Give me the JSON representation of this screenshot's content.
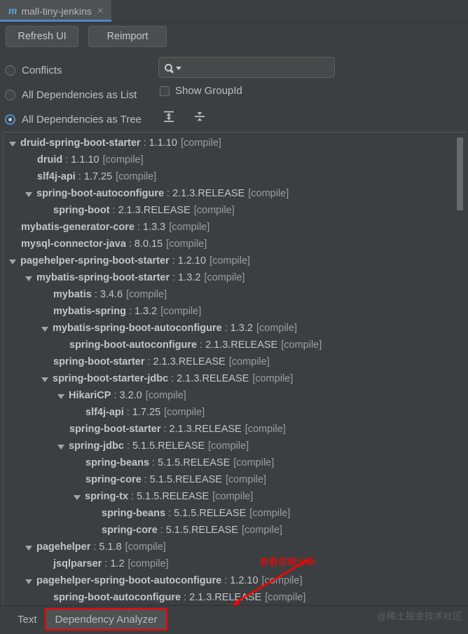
{
  "tab": {
    "icon": "maven-m-icon",
    "title": "mall-tiny-jenkins",
    "close": "×"
  },
  "toolbar": {
    "refresh_label": "Refresh UI",
    "reimport_label": "Reimport"
  },
  "options": {
    "items": [
      {
        "label": "Conflicts",
        "selected": false
      },
      {
        "label": "All Dependencies as List",
        "selected": false
      },
      {
        "label": "All Dependencies as Tree",
        "selected": true
      }
    ]
  },
  "search": {
    "value": "",
    "placeholder": "",
    "icon": "search-icon",
    "dropdown_icon": "chevron-down-icon"
  },
  "show_groupid": {
    "label": "Show GroupId",
    "checked": false
  },
  "tree_tools": {
    "expand_all": "expand-all-icon",
    "collapse_all": "collapse-all-icon"
  },
  "tree": {
    "scope_suffix": "[compile]",
    "separator": ":",
    "rows": [
      {
        "depth": 0,
        "expanded": true,
        "artifact": "druid-spring-boot-starter",
        "version": "1.1.10",
        "scope": "[compile]"
      },
      {
        "depth": 1,
        "expanded": null,
        "artifact": "druid",
        "version": "1.1.10",
        "scope": "[compile]"
      },
      {
        "depth": 1,
        "expanded": null,
        "artifact": "slf4j-api",
        "version": "1.7.25",
        "scope": "[compile]"
      },
      {
        "depth": 1,
        "expanded": true,
        "artifact": "spring-boot-autoconfigure",
        "version": "2.1.3.RELEASE",
        "scope": "[compile]"
      },
      {
        "depth": 2,
        "expanded": null,
        "artifact": "spring-boot",
        "version": "2.1.3.RELEASE",
        "scope": "[compile]"
      },
      {
        "depth": 0,
        "expanded": null,
        "artifact": "mybatis-generator-core",
        "version": "1.3.3",
        "scope": "[compile]"
      },
      {
        "depth": 0,
        "expanded": null,
        "artifact": "mysql-connector-java",
        "version": "8.0.15",
        "scope": "[compile]"
      },
      {
        "depth": 0,
        "expanded": true,
        "artifact": "pagehelper-spring-boot-starter",
        "version": "1.2.10",
        "scope": "[compile]"
      },
      {
        "depth": 1,
        "expanded": true,
        "artifact": "mybatis-spring-boot-starter",
        "version": "1.3.2",
        "scope": "[compile]"
      },
      {
        "depth": 2,
        "expanded": null,
        "artifact": "mybatis",
        "version": "3.4.6",
        "scope": "[compile]"
      },
      {
        "depth": 2,
        "expanded": null,
        "artifact": "mybatis-spring",
        "version": "1.3.2",
        "scope": "[compile]"
      },
      {
        "depth": 2,
        "expanded": true,
        "artifact": "mybatis-spring-boot-autoconfigure",
        "version": "1.3.2",
        "scope": "[compile]"
      },
      {
        "depth": 3,
        "expanded": null,
        "artifact": "spring-boot-autoconfigure",
        "version": "2.1.3.RELEASE",
        "scope": "[compile]"
      },
      {
        "depth": 2,
        "expanded": null,
        "artifact": "spring-boot-starter",
        "version": "2.1.3.RELEASE",
        "scope": "[compile]"
      },
      {
        "depth": 2,
        "expanded": true,
        "artifact": "spring-boot-starter-jdbc",
        "version": "2.1.3.RELEASE",
        "scope": "[compile]"
      },
      {
        "depth": 3,
        "expanded": true,
        "artifact": "HikariCP",
        "version": "3.2.0",
        "scope": "[compile]"
      },
      {
        "depth": 4,
        "expanded": null,
        "artifact": "slf4j-api",
        "version": "1.7.25",
        "scope": "[compile]"
      },
      {
        "depth": 3,
        "expanded": null,
        "artifact": "spring-boot-starter",
        "version": "2.1.3.RELEASE",
        "scope": "[compile]"
      },
      {
        "depth": 3,
        "expanded": true,
        "artifact": "spring-jdbc",
        "version": "5.1.5.RELEASE",
        "scope": "[compile]"
      },
      {
        "depth": 4,
        "expanded": null,
        "artifact": "spring-beans",
        "version": "5.1.5.RELEASE",
        "scope": "[compile]"
      },
      {
        "depth": 4,
        "expanded": null,
        "artifact": "spring-core",
        "version": "5.1.5.RELEASE",
        "scope": "[compile]"
      },
      {
        "depth": 4,
        "expanded": true,
        "artifact": "spring-tx",
        "version": "5.1.5.RELEASE",
        "scope": "[compile]"
      },
      {
        "depth": 5,
        "expanded": null,
        "artifact": "spring-beans",
        "version": "5.1.5.RELEASE",
        "scope": "[compile]"
      },
      {
        "depth": 5,
        "expanded": null,
        "artifact": "spring-core",
        "version": "5.1.5.RELEASE",
        "scope": "[compile]"
      },
      {
        "depth": 1,
        "expanded": true,
        "artifact": "pagehelper",
        "version": "5.1.8",
        "scope": "[compile]"
      },
      {
        "depth": 2,
        "expanded": null,
        "artifact": "jsqlparser",
        "version": "1.2",
        "scope": "[compile]"
      },
      {
        "depth": 1,
        "expanded": true,
        "artifact": "pagehelper-spring-boot-autoconfigure",
        "version": "1.2.10",
        "scope": "[compile]"
      },
      {
        "depth": 2,
        "expanded": null,
        "artifact": "spring-boot-autoconfigure",
        "version": "2.1.3.RELEASE",
        "scope": "[compile]"
      }
    ]
  },
  "annotation": {
    "text": "查看依赖分析",
    "color": "#ff0000"
  },
  "bottom": {
    "tabs": [
      {
        "label": "Text",
        "active": false,
        "highlighted": false
      },
      {
        "label": "Dependency Analyzer",
        "active": true,
        "highlighted": true
      }
    ],
    "watermark": "@稀土掘金技术社区"
  },
  "colors": {
    "background": "#3c3f41",
    "accent": "#4a88c7",
    "annotation": "#ff0000",
    "text": "#c3c6c7"
  }
}
